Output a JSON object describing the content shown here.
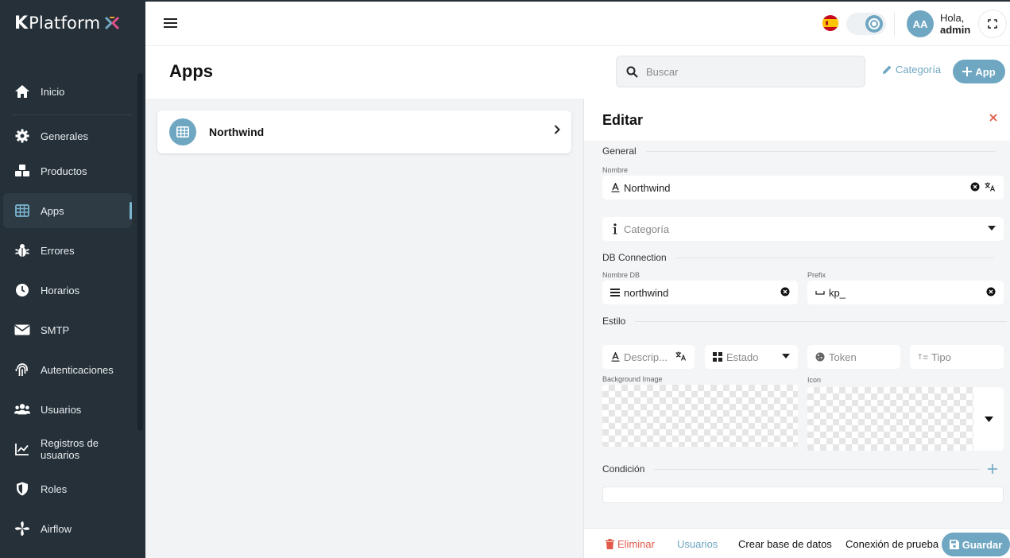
{
  "brand": {
    "logo_text": "Platform",
    "logo_letter": "K"
  },
  "sidebar": {
    "items": [
      {
        "label": "Inicio",
        "icon": "home-icon"
      },
      {
        "label": "Generales",
        "icon": "gear-icon"
      },
      {
        "label": "Productos",
        "icon": "cubes-icon"
      },
      {
        "label": "Apps",
        "icon": "table-icon",
        "active": true
      },
      {
        "label": "Errores",
        "icon": "bug-icon"
      },
      {
        "label": "Horarios",
        "icon": "clock-icon"
      },
      {
        "label": "SMTP",
        "icon": "envelope-icon"
      },
      {
        "label": "Autenticaciones",
        "icon": "fingerprint-icon"
      },
      {
        "label": "Usuarios",
        "icon": "users-icon"
      },
      {
        "label": "Registros de usuarios",
        "icon": "chart-line-icon"
      },
      {
        "label": "Roles",
        "icon": "shield-icon"
      },
      {
        "label": "Airflow",
        "icon": "fan-icon"
      }
    ]
  },
  "topbar": {
    "avatar_initials": "AA",
    "greeting": "Hola,",
    "username": "admin"
  },
  "header": {
    "title": "Apps",
    "search_placeholder": "Buscar",
    "category_label": "Categoría",
    "add_app_label": "App"
  },
  "apps": [
    {
      "name": "Northwind"
    }
  ],
  "panel": {
    "title": "Editar",
    "section_general": "General",
    "nombre_label": "Nombre",
    "nombre_value": "Northwind",
    "categoria_placeholder": "Categoría",
    "section_db": "DB Connection",
    "nombre_db_label": "Nombre DB",
    "nombre_db_value": "northwind",
    "prefix_label": "Prefix",
    "prefix_value": "kp_",
    "section_estilo": "Estilo",
    "descripcion_placeholder": "Descrip...",
    "estado_placeholder": "Estado",
    "token_placeholder": "Token",
    "tipo_placeholder": "Tipo",
    "background_image_label": "Background Image",
    "icon_label": "Icon",
    "section_condicion": "Condición"
  },
  "footer": {
    "delete_label": "Eliminar",
    "users_label": "Usuarios",
    "create_db_label": "Crear base de datos",
    "test_connection_label": "Conexión de prueba",
    "save_label": "Guardar"
  },
  "colors": {
    "accent": "#6fa7c2",
    "sidebar_bg": "#253038",
    "danger": "#e05a4a"
  }
}
